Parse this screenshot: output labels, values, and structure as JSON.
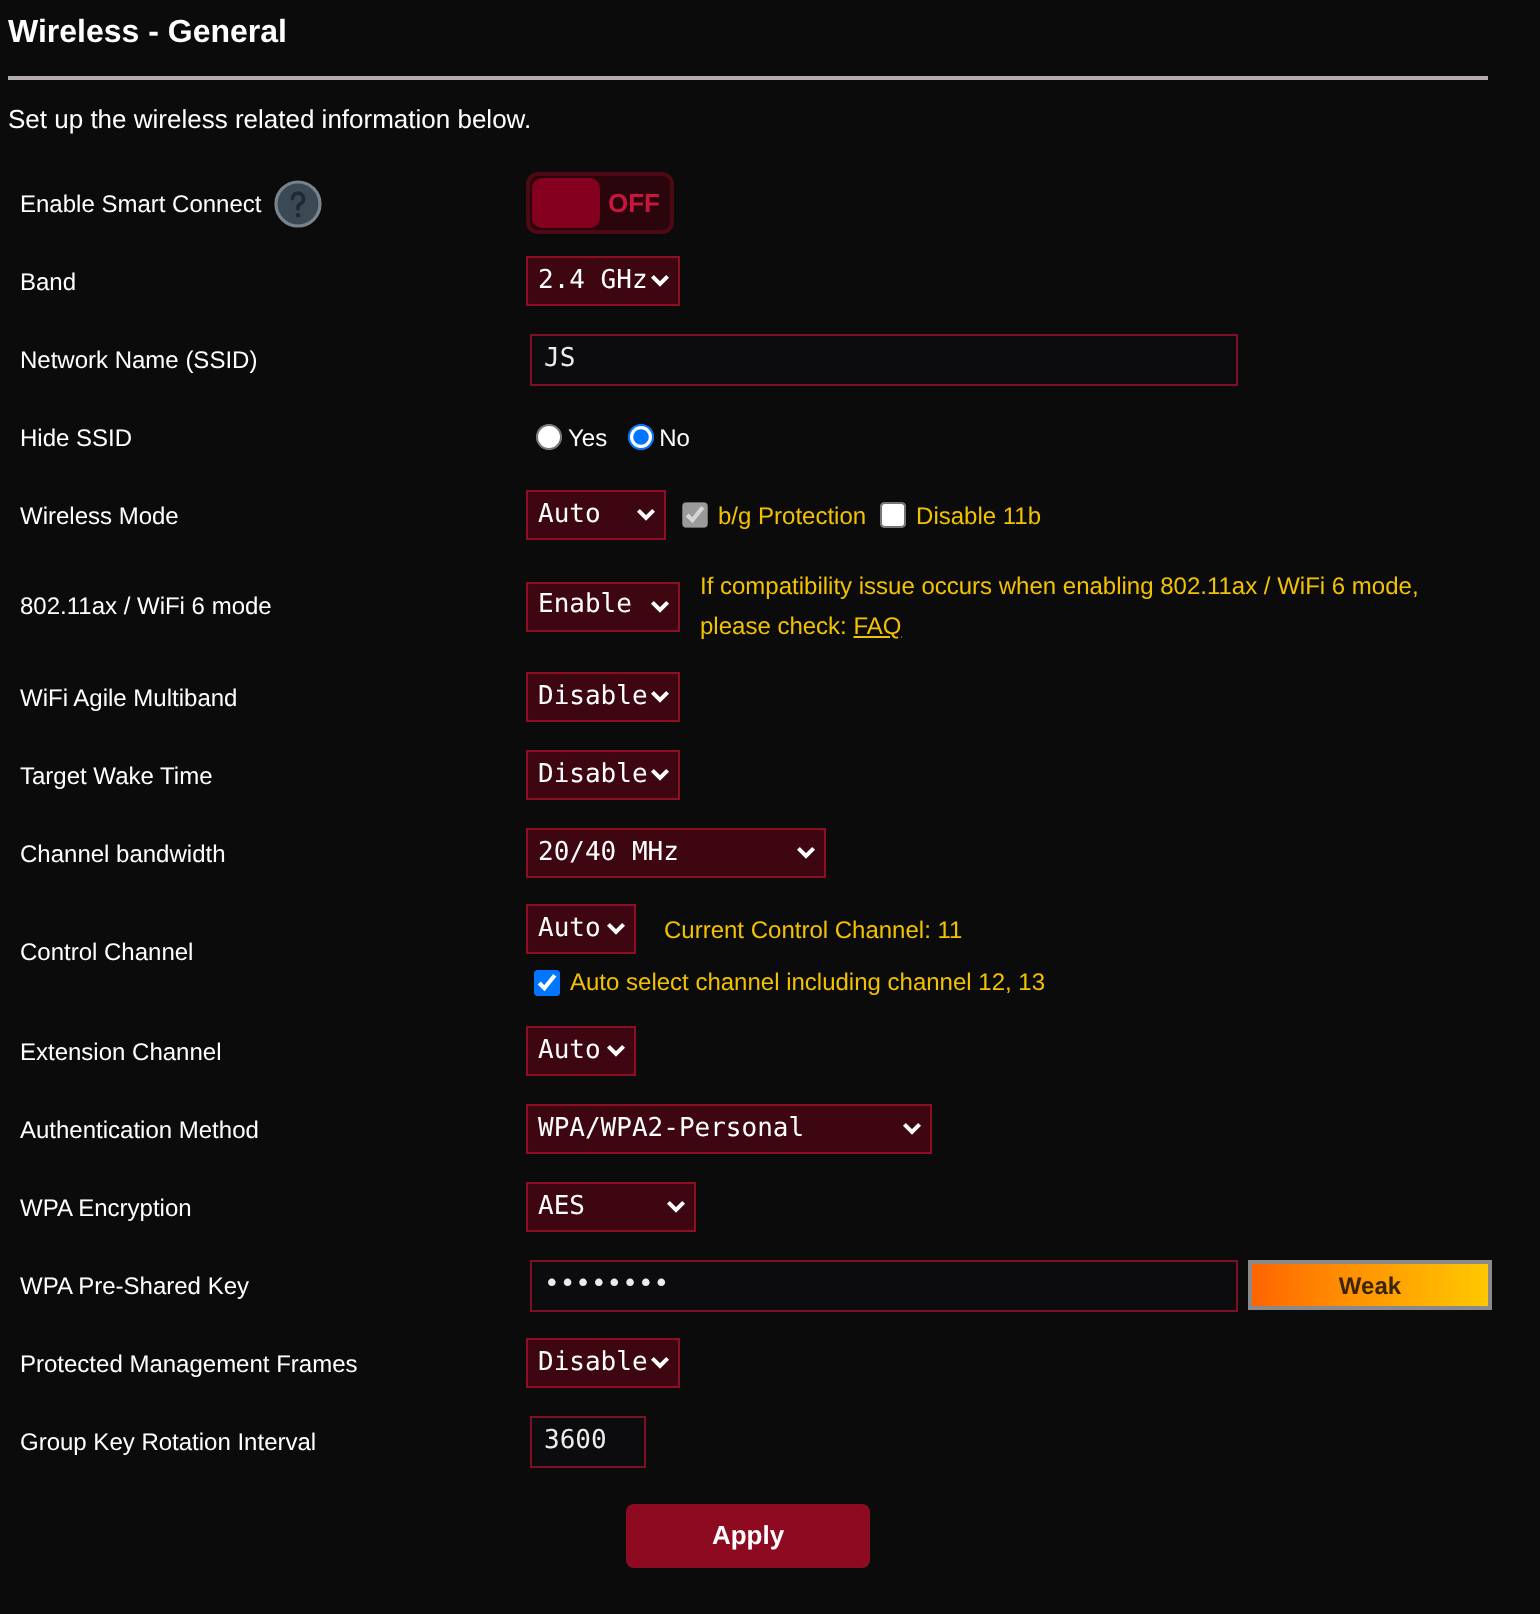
{
  "page": {
    "title": "Wireless - General",
    "description": "Set up the wireless related information below."
  },
  "rows": [
    {
      "kind": "toggle",
      "label": "Enable Smart Connect",
      "help": true,
      "on": false,
      "state_text": "OFF"
    },
    {
      "kind": "select",
      "label": "Band",
      "value": "2.4 GHz"
    },
    {
      "kind": "text",
      "label": "Network Name (SSID)",
      "value": "JS"
    },
    {
      "kind": "radio",
      "label": "Hide SSID",
      "options": [
        {
          "label": "Yes",
          "selected": false
        },
        {
          "label": "No",
          "selected": true
        }
      ]
    },
    {
      "kind": "select",
      "label": "Wireless Mode",
      "value": "Auto",
      "checkboxes": [
        {
          "label": "b/g Protection",
          "checked": true,
          "disabled": true
        },
        {
          "label": "Disable 11b",
          "checked": false,
          "disabled": false
        }
      ]
    },
    {
      "kind": "select",
      "label": "802.11ax / WiFi 6 mode",
      "value": "Enable",
      "note": {
        "text": "If compatibility issue occurs when enabling 802.11ax / WiFi 6 mode, please check:",
        "link": "FAQ"
      }
    },
    {
      "kind": "select",
      "label": "WiFi Agile Multiband",
      "value": "Disable"
    },
    {
      "kind": "select",
      "label": "Target Wake Time",
      "value": "Disable"
    },
    {
      "kind": "select",
      "label": "Channel bandwidth",
      "value": "20/40 MHz"
    },
    {
      "kind": "select",
      "label": "Control Channel",
      "value": "Auto",
      "status": "Current Control Channel: 11",
      "checkbox_below": {
        "label": "Auto select channel including channel 12, 13",
        "checked": true
      }
    },
    {
      "kind": "select",
      "label": "Extension Channel",
      "value": "Auto"
    },
    {
      "kind": "select",
      "label": "Authentication Method",
      "value": "WPA/WPA2-Personal"
    },
    {
      "kind": "select",
      "label": "WPA Encryption",
      "value": "AES"
    },
    {
      "kind": "password",
      "label": "WPA Pre-Shared Key",
      "value": "••••••••",
      "strength": "Weak"
    },
    {
      "kind": "select",
      "label": "Protected Management Frames",
      "value": "Disable"
    },
    {
      "kind": "text",
      "label": "Group Key Rotation Interval",
      "value": "3600"
    }
  ],
  "apply_button": "Apply"
}
